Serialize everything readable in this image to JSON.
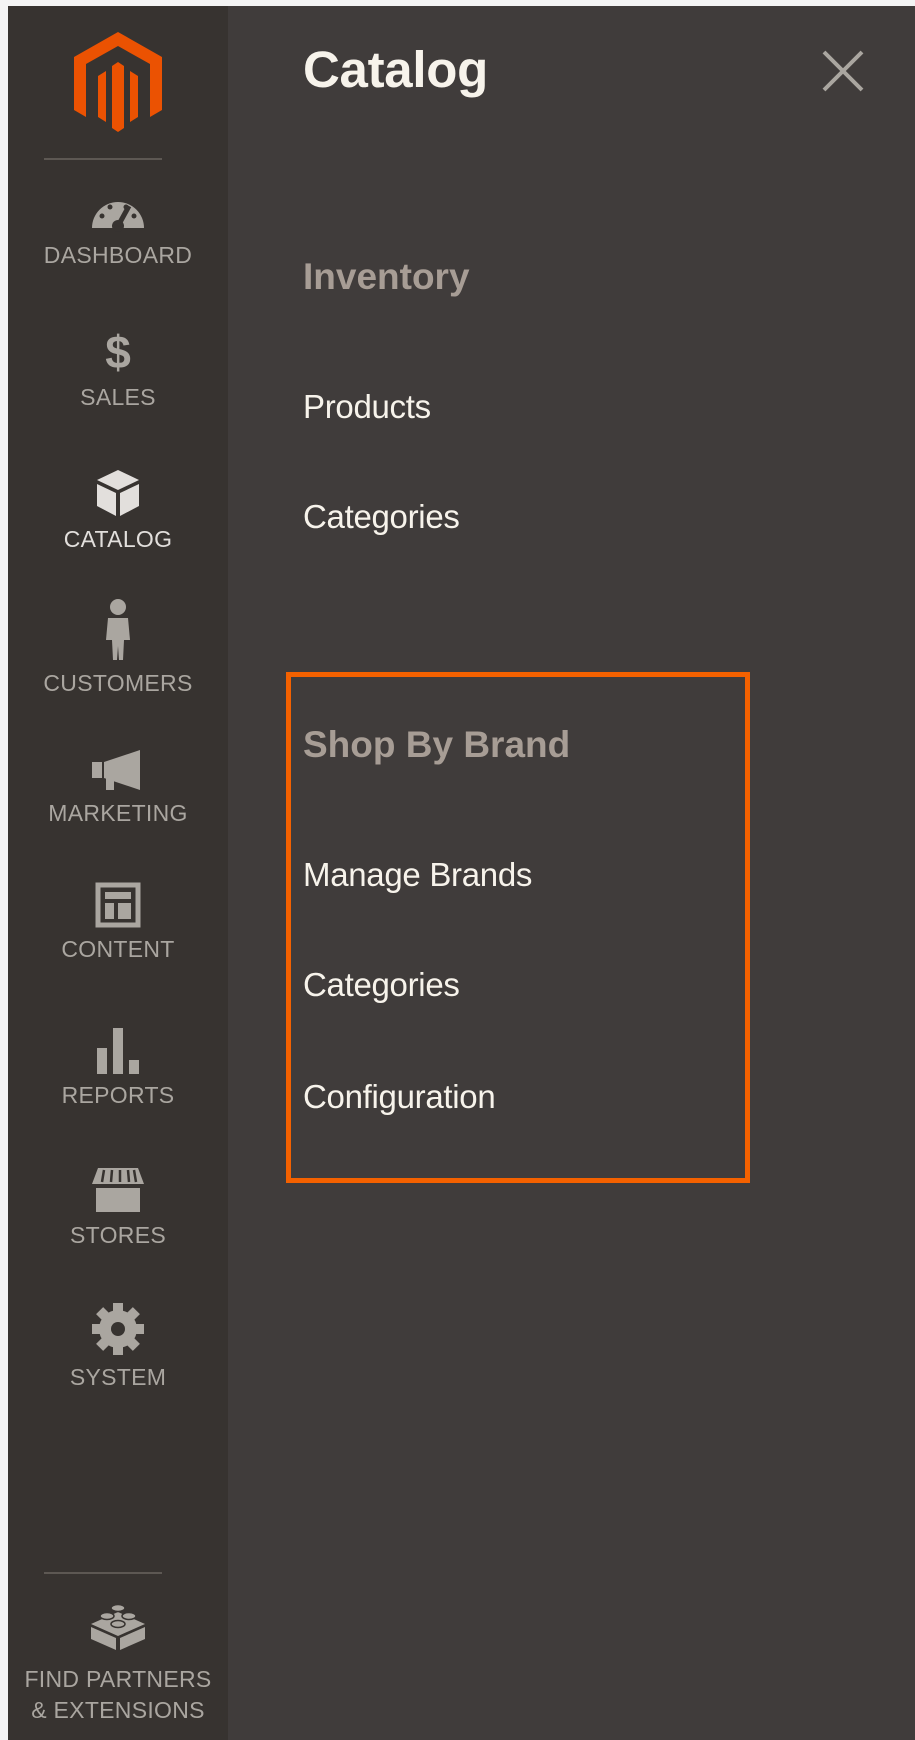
{
  "sidebar": {
    "items": [
      {
        "label": "DASHBOARD",
        "icon": "dashboard-icon"
      },
      {
        "label": "SALES",
        "icon": "dollar-icon"
      },
      {
        "label": "CATALOG",
        "icon": "box-icon"
      },
      {
        "label": "CUSTOMERS",
        "icon": "person-icon"
      },
      {
        "label": "MARKETING",
        "icon": "megaphone-icon"
      },
      {
        "label": "CONTENT",
        "icon": "layout-icon"
      },
      {
        "label": "REPORTS",
        "icon": "bar-chart-icon"
      },
      {
        "label": "STORES",
        "icon": "storefront-icon"
      },
      {
        "label": "SYSTEM",
        "icon": "gear-icon"
      }
    ],
    "partners_line1": "FIND PARTNERS",
    "partners_line2": "& EXTENSIONS"
  },
  "panel": {
    "title": "Catalog",
    "sections": [
      {
        "heading": "Inventory",
        "links": [
          "Products",
          "Categories"
        ]
      },
      {
        "heading": "Shop By Brand",
        "links": [
          "Manage Brands",
          "Categories",
          "Configuration"
        ]
      }
    ]
  },
  "colors": {
    "sidebar_bg": "#373330",
    "panel_bg": "#403c3b",
    "accent": "#f46100",
    "logo": "#eb5202"
  }
}
